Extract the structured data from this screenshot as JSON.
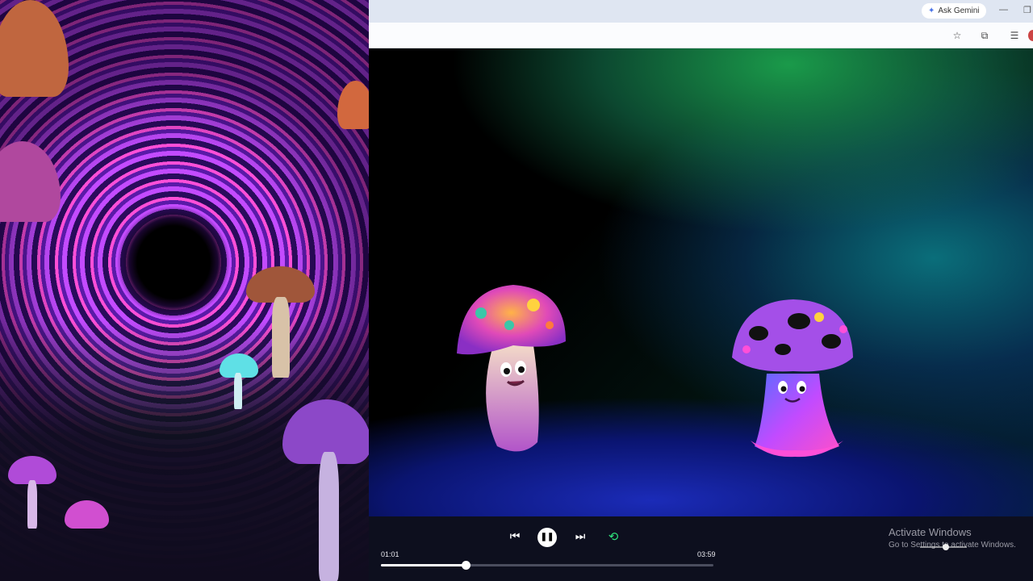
{
  "browser": {
    "ask_gemini_label": "Ask Gemini",
    "ask_gemini_icon": "sparkle-icon",
    "window_buttons": [
      "minimize-icon",
      "restore-icon"
    ],
    "toolbar_icons": [
      "bookmark-star-icon",
      "extensions-icon",
      "reading-list-icon"
    ]
  },
  "player": {
    "current_time": "01:01",
    "total_time": "03:59",
    "progress": 0.255,
    "state": "playing",
    "controls": [
      "previous-icon",
      "pause-icon",
      "next-icon",
      "repeat-icon"
    ],
    "accent_color": "#2ee07a"
  },
  "overlay": {
    "watermark_title": "Activate Windows",
    "watermark_subtitle": "Go to Settings to activate Windows.",
    "volume_level": 0.55
  }
}
